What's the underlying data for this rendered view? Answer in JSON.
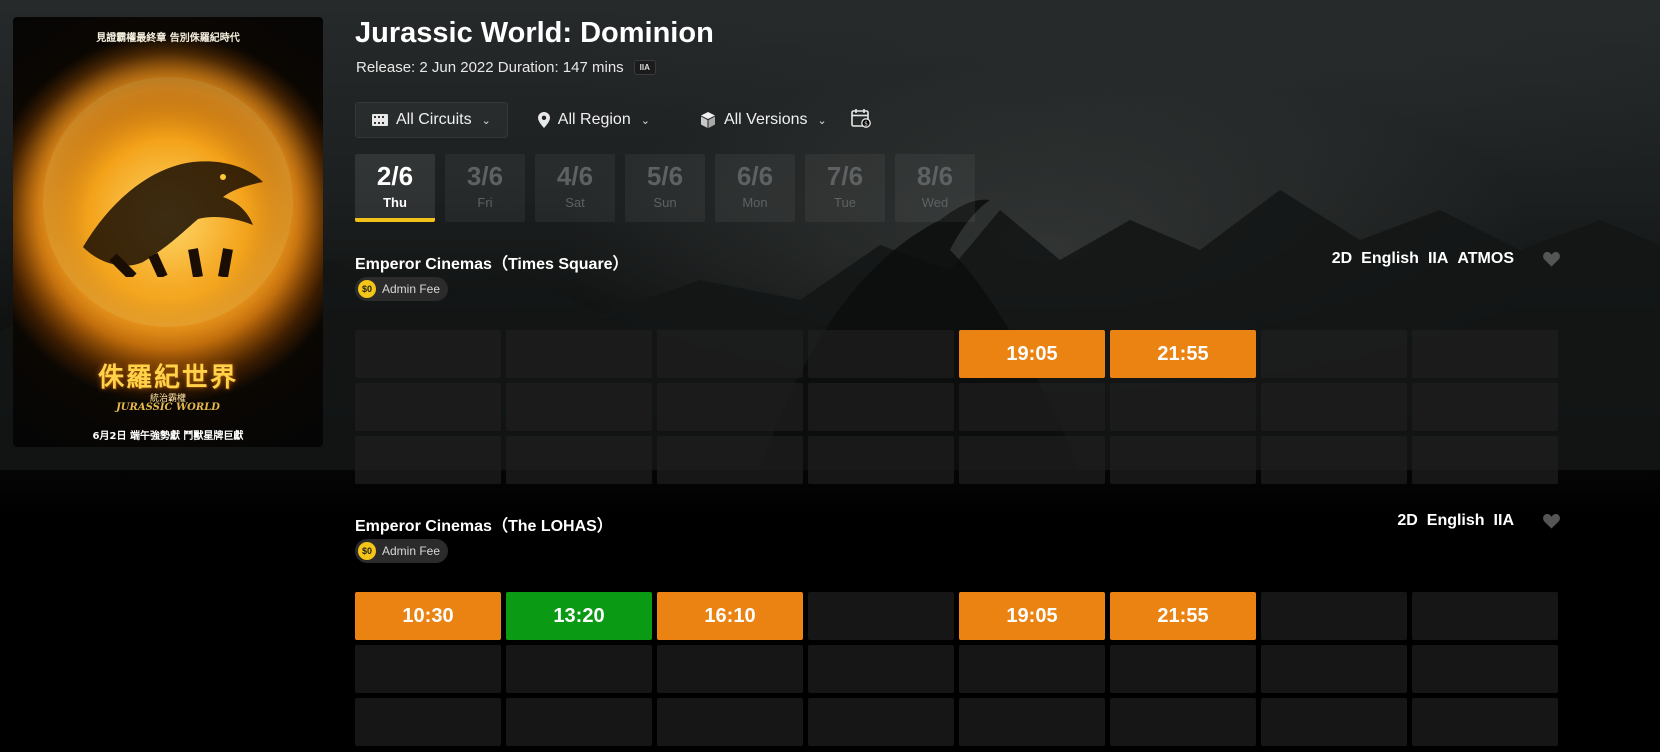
{
  "poster": {
    "tagline": "見證霸權最終章 告別侏羅紀時代",
    "title_zh": "侏羅紀世界",
    "subtitle_zh": "統治霸權",
    "logo": "JURASSIC WORLD",
    "release_zh": "6月2日 端午強勢獻 鬥獸星牌巨獻"
  },
  "movie": {
    "title": "Jurassic World: Dominion",
    "meta": "Release: 2 Jun 2022 Duration: 147 mins",
    "rating": "IIA"
  },
  "filters": {
    "circuits": "All Circuits",
    "region": "All Region",
    "versions": "All Versions"
  },
  "dates": [
    {
      "date": "2/6",
      "day": "Thu",
      "active": true
    },
    {
      "date": "3/6",
      "day": "Fri",
      "active": false
    },
    {
      "date": "4/6",
      "day": "Sat",
      "active": false
    },
    {
      "date": "5/6",
      "day": "Sun",
      "active": false
    },
    {
      "date": "6/6",
      "day": "Mon",
      "active": false
    },
    {
      "date": "7/6",
      "day": "Tue",
      "active": false
    },
    {
      "date": "8/6",
      "day": "Wed",
      "active": false
    }
  ],
  "cinemas": [
    {
      "name": "Emperor Cinemas（Times Square）",
      "tags": [
        "2D",
        "English",
        "IIA",
        "ATMOS"
      ],
      "admin_fee_amount": "$0",
      "admin_fee_label": "Admin Fee",
      "slots": [
        {
          "time": "",
          "status": "empty"
        },
        {
          "time": "",
          "status": "empty"
        },
        {
          "time": "",
          "status": "empty"
        },
        {
          "time": "",
          "status": "empty"
        },
        {
          "time": "19:05",
          "status": "orange"
        },
        {
          "time": "21:55",
          "status": "orange"
        },
        {
          "time": "",
          "status": "empty"
        },
        {
          "time": "",
          "status": "empty"
        },
        {
          "time": "",
          "status": "empty"
        },
        {
          "time": "",
          "status": "empty"
        },
        {
          "time": "",
          "status": "empty"
        },
        {
          "time": "",
          "status": "empty"
        },
        {
          "time": "",
          "status": "empty"
        },
        {
          "time": "",
          "status": "empty"
        },
        {
          "time": "",
          "status": "empty"
        },
        {
          "time": "",
          "status": "empty"
        },
        {
          "time": "",
          "status": "empty"
        },
        {
          "time": "",
          "status": "empty"
        },
        {
          "time": "",
          "status": "empty"
        },
        {
          "time": "",
          "status": "empty"
        },
        {
          "time": "",
          "status": "empty"
        },
        {
          "time": "",
          "status": "empty"
        },
        {
          "time": "",
          "status": "empty"
        },
        {
          "time": "",
          "status": "empty"
        }
      ]
    },
    {
      "name": "Emperor Cinemas（The LOHAS）",
      "tags": [
        "2D",
        "English",
        "IIA"
      ],
      "admin_fee_amount": "$0",
      "admin_fee_label": "Admin Fee",
      "slots": [
        {
          "time": "10:30",
          "status": "orange"
        },
        {
          "time": "13:20",
          "status": "green"
        },
        {
          "time": "16:10",
          "status": "orange"
        },
        {
          "time": "",
          "status": "empty"
        },
        {
          "time": "19:05",
          "status": "orange"
        },
        {
          "time": "21:55",
          "status": "orange"
        },
        {
          "time": "",
          "status": "empty"
        },
        {
          "time": "",
          "status": "empty"
        },
        {
          "time": "",
          "status": "empty"
        },
        {
          "time": "",
          "status": "empty"
        },
        {
          "time": "",
          "status": "empty"
        },
        {
          "time": "",
          "status": "empty"
        },
        {
          "time": "",
          "status": "empty"
        },
        {
          "time": "",
          "status": "empty"
        },
        {
          "time": "",
          "status": "empty"
        },
        {
          "time": "",
          "status": "empty"
        },
        {
          "time": "",
          "status": "empty"
        },
        {
          "time": "",
          "status": "empty"
        },
        {
          "time": "",
          "status": "empty"
        },
        {
          "time": "",
          "status": "empty"
        },
        {
          "time": "",
          "status": "empty"
        },
        {
          "time": "",
          "status": "empty"
        },
        {
          "time": "",
          "status": "empty"
        },
        {
          "time": "",
          "status": "empty"
        }
      ]
    }
  ],
  "colors": {
    "accent": "#f2c21b",
    "slot_orange": "#ea8311",
    "slot_green": "#0a9a13",
    "slot_empty": "#1e1e1e"
  },
  "icons": {
    "circuits": "film-strip-icon",
    "region": "map-pin-icon",
    "versions": "cube-icon",
    "calendar": "calendar-price-icon",
    "favorite": "heart-icon",
    "chevron": "chevron-down-icon"
  }
}
